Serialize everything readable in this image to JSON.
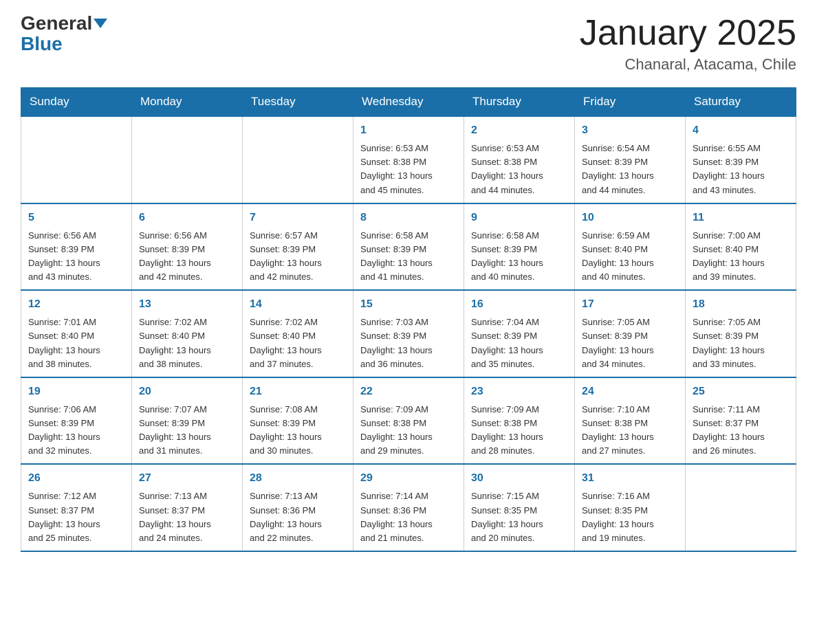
{
  "header": {
    "logo_top": "General",
    "logo_bottom": "Blue",
    "title": "January 2025",
    "location": "Chanaral, Atacama, Chile"
  },
  "weekdays": [
    "Sunday",
    "Monday",
    "Tuesday",
    "Wednesday",
    "Thursday",
    "Friday",
    "Saturday"
  ],
  "weeks": [
    [
      {
        "day": "",
        "info": ""
      },
      {
        "day": "",
        "info": ""
      },
      {
        "day": "",
        "info": ""
      },
      {
        "day": "1",
        "info": "Sunrise: 6:53 AM\nSunset: 8:38 PM\nDaylight: 13 hours\nand 45 minutes."
      },
      {
        "day": "2",
        "info": "Sunrise: 6:53 AM\nSunset: 8:38 PM\nDaylight: 13 hours\nand 44 minutes."
      },
      {
        "day": "3",
        "info": "Sunrise: 6:54 AM\nSunset: 8:39 PM\nDaylight: 13 hours\nand 44 minutes."
      },
      {
        "day": "4",
        "info": "Sunrise: 6:55 AM\nSunset: 8:39 PM\nDaylight: 13 hours\nand 43 minutes."
      }
    ],
    [
      {
        "day": "5",
        "info": "Sunrise: 6:56 AM\nSunset: 8:39 PM\nDaylight: 13 hours\nand 43 minutes."
      },
      {
        "day": "6",
        "info": "Sunrise: 6:56 AM\nSunset: 8:39 PM\nDaylight: 13 hours\nand 42 minutes."
      },
      {
        "day": "7",
        "info": "Sunrise: 6:57 AM\nSunset: 8:39 PM\nDaylight: 13 hours\nand 42 minutes."
      },
      {
        "day": "8",
        "info": "Sunrise: 6:58 AM\nSunset: 8:39 PM\nDaylight: 13 hours\nand 41 minutes."
      },
      {
        "day": "9",
        "info": "Sunrise: 6:58 AM\nSunset: 8:39 PM\nDaylight: 13 hours\nand 40 minutes."
      },
      {
        "day": "10",
        "info": "Sunrise: 6:59 AM\nSunset: 8:40 PM\nDaylight: 13 hours\nand 40 minutes."
      },
      {
        "day": "11",
        "info": "Sunrise: 7:00 AM\nSunset: 8:40 PM\nDaylight: 13 hours\nand 39 minutes."
      }
    ],
    [
      {
        "day": "12",
        "info": "Sunrise: 7:01 AM\nSunset: 8:40 PM\nDaylight: 13 hours\nand 38 minutes."
      },
      {
        "day": "13",
        "info": "Sunrise: 7:02 AM\nSunset: 8:40 PM\nDaylight: 13 hours\nand 38 minutes."
      },
      {
        "day": "14",
        "info": "Sunrise: 7:02 AM\nSunset: 8:40 PM\nDaylight: 13 hours\nand 37 minutes."
      },
      {
        "day": "15",
        "info": "Sunrise: 7:03 AM\nSunset: 8:39 PM\nDaylight: 13 hours\nand 36 minutes."
      },
      {
        "day": "16",
        "info": "Sunrise: 7:04 AM\nSunset: 8:39 PM\nDaylight: 13 hours\nand 35 minutes."
      },
      {
        "day": "17",
        "info": "Sunrise: 7:05 AM\nSunset: 8:39 PM\nDaylight: 13 hours\nand 34 minutes."
      },
      {
        "day": "18",
        "info": "Sunrise: 7:05 AM\nSunset: 8:39 PM\nDaylight: 13 hours\nand 33 minutes."
      }
    ],
    [
      {
        "day": "19",
        "info": "Sunrise: 7:06 AM\nSunset: 8:39 PM\nDaylight: 13 hours\nand 32 minutes."
      },
      {
        "day": "20",
        "info": "Sunrise: 7:07 AM\nSunset: 8:39 PM\nDaylight: 13 hours\nand 31 minutes."
      },
      {
        "day": "21",
        "info": "Sunrise: 7:08 AM\nSunset: 8:39 PM\nDaylight: 13 hours\nand 30 minutes."
      },
      {
        "day": "22",
        "info": "Sunrise: 7:09 AM\nSunset: 8:38 PM\nDaylight: 13 hours\nand 29 minutes."
      },
      {
        "day": "23",
        "info": "Sunrise: 7:09 AM\nSunset: 8:38 PM\nDaylight: 13 hours\nand 28 minutes."
      },
      {
        "day": "24",
        "info": "Sunrise: 7:10 AM\nSunset: 8:38 PM\nDaylight: 13 hours\nand 27 minutes."
      },
      {
        "day": "25",
        "info": "Sunrise: 7:11 AM\nSunset: 8:37 PM\nDaylight: 13 hours\nand 26 minutes."
      }
    ],
    [
      {
        "day": "26",
        "info": "Sunrise: 7:12 AM\nSunset: 8:37 PM\nDaylight: 13 hours\nand 25 minutes."
      },
      {
        "day": "27",
        "info": "Sunrise: 7:13 AM\nSunset: 8:37 PM\nDaylight: 13 hours\nand 24 minutes."
      },
      {
        "day": "28",
        "info": "Sunrise: 7:13 AM\nSunset: 8:36 PM\nDaylight: 13 hours\nand 22 minutes."
      },
      {
        "day": "29",
        "info": "Sunrise: 7:14 AM\nSunset: 8:36 PM\nDaylight: 13 hours\nand 21 minutes."
      },
      {
        "day": "30",
        "info": "Sunrise: 7:15 AM\nSunset: 8:35 PM\nDaylight: 13 hours\nand 20 minutes."
      },
      {
        "day": "31",
        "info": "Sunrise: 7:16 AM\nSunset: 8:35 PM\nDaylight: 13 hours\nand 19 minutes."
      },
      {
        "day": "",
        "info": ""
      }
    ]
  ]
}
